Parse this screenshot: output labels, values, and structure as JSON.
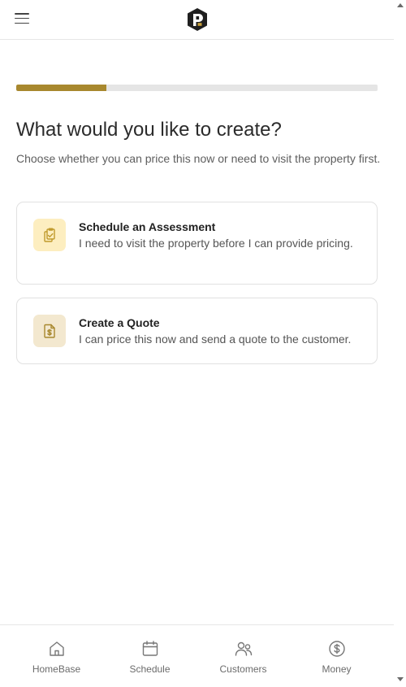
{
  "header": {
    "menu_icon": "hamburger-menu-icon",
    "logo_icon": "p-logo-icon"
  },
  "progress": {
    "value_percent": 25,
    "fill_color": "#a8882e",
    "track_color": "#e5e5e5"
  },
  "page": {
    "title": "What would you like to create?",
    "subtitle": "Choose whether you can price this now or need to visit the property first."
  },
  "options": [
    {
      "title": "Schedule an Assessment",
      "description": "I need to visit the property before I can provide pricing.",
      "icon": "clipboard-check-icon"
    },
    {
      "title": "Create a Quote",
      "description": "I can price this now and send a quote to the customer.",
      "icon": "dollar-document-icon"
    }
  ],
  "nav": {
    "items": [
      {
        "label": "HomeBase",
        "icon": "home-icon"
      },
      {
        "label": "Schedule",
        "icon": "calendar-icon"
      },
      {
        "label": "Customers",
        "icon": "users-icon"
      },
      {
        "label": "Money",
        "icon": "dollar-circle-icon"
      }
    ]
  },
  "colors": {
    "accent": "#a8882e",
    "assessment_icon_bg": "#fdeec0",
    "quote_icon_bg": "#f3e8cf"
  }
}
